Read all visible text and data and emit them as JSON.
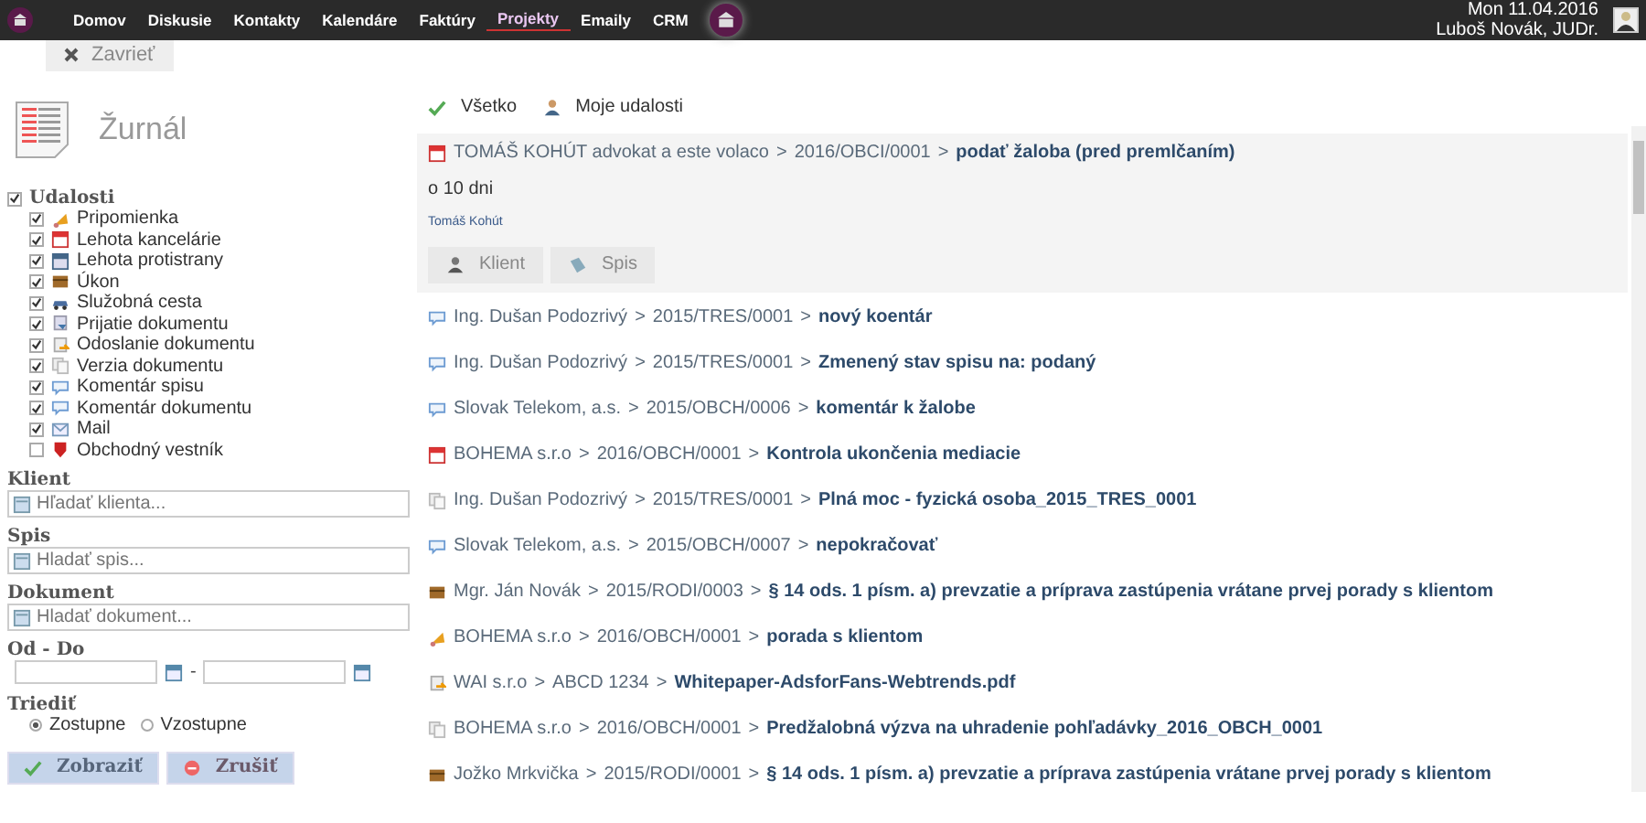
{
  "nav": {
    "items": [
      {
        "label": "Domov",
        "selected": false
      },
      {
        "label": "Diskusie",
        "selected": false
      },
      {
        "label": "Kontakty",
        "selected": false
      },
      {
        "label": "Kalendáre",
        "selected": false
      },
      {
        "label": "Faktúry",
        "selected": false
      },
      {
        "label": "Projekty",
        "selected": true
      },
      {
        "label": "Emaily",
        "selected": false
      },
      {
        "label": "CRM",
        "selected": false
      }
    ],
    "date": "Mon 11.04.2016",
    "user": "Luboš Novák, JUDr."
  },
  "close_button": "Zavrieť",
  "page_title": "Žurnál",
  "filters": {
    "group": {
      "label": "Udalosti",
      "checked": true
    },
    "categories": [
      {
        "label": "Pripomienka",
        "kind": "reminder",
        "checked": true
      },
      {
        "label": "Lehota kancelárie",
        "kind": "deadline",
        "checked": true
      },
      {
        "label": "Lehota protistrany",
        "kind": "opponent",
        "checked": true
      },
      {
        "label": "Úkon",
        "kind": "act",
        "checked": true
      },
      {
        "label": "Služobná cesta",
        "kind": "trip",
        "checked": true
      },
      {
        "label": "Prijatie dokumentu",
        "kind": "docin",
        "checked": true
      },
      {
        "label": "Odoslanie dokumentu",
        "kind": "docout",
        "checked": true
      },
      {
        "label": "Verzia dokumentu",
        "kind": "version",
        "checked": true
      },
      {
        "label": "Komentár spisu",
        "kind": "comment",
        "checked": true
      },
      {
        "label": "Komentár dokumentu",
        "kind": "comment",
        "checked": true
      },
      {
        "label": "Mail",
        "kind": "mail",
        "checked": true
      },
      {
        "label": "Obchodný vestník",
        "kind": "gazette",
        "checked": false
      }
    ],
    "fields": [
      {
        "label": "Klient",
        "placeholder": "Hľadať klienta..."
      },
      {
        "label": "Spis",
        "placeholder": "Hladať spis..."
      },
      {
        "label": "Dokument",
        "placeholder": "Hladať dokument..."
      }
    ],
    "range_label": "Od - Do",
    "range_separator": "-",
    "sort_label": "Triediť",
    "sort_options": [
      {
        "label": "Zostupne",
        "selected": true
      },
      {
        "label": "Vzostupne",
        "selected": false
      }
    ],
    "buttons": [
      {
        "label": "Zobraziť",
        "kind": "ok"
      },
      {
        "label": "Zrušiť",
        "kind": "cancel"
      }
    ]
  },
  "view_tabs": [
    {
      "label": "Všetko",
      "kind": "all"
    },
    {
      "label": "Moje udalosti",
      "kind": "mine"
    }
  ],
  "events": [
    {
      "kind": "deadline",
      "client": "TOMÁŠ KOHÚT advokat a este volaco",
      "file": "2016/OBCI/0001",
      "title": "podať žaloba (pred premlčaním)",
      "detail": {
        "due": "o 10 dni",
        "person": "Tomáš Kohút",
        "buttons": [
          {
            "label": "Klient",
            "kind": "client"
          },
          {
            "label": "Spis",
            "kind": "file"
          }
        ]
      }
    },
    {
      "kind": "comment",
      "client": "Ing. Dušan Podozrivý",
      "file": "2015/TRES/0001",
      "title": "nový koentár"
    },
    {
      "kind": "comment",
      "client": "Ing. Dušan Podozrivý",
      "file": "2015/TRES/0001",
      "title": "Zmenený stav spisu na: podaný"
    },
    {
      "kind": "comment",
      "client": "Slovak Telekom, a.s.",
      "file": "2015/OBCH/0006",
      "title": "komentár k žalobe"
    },
    {
      "kind": "deadline",
      "client": "BOHEMA s.r.o",
      "file": "2016/OBCH/0001",
      "title": "Kontrola ukončenia mediacie"
    },
    {
      "kind": "version",
      "client": "Ing. Dušan Podozrivý",
      "file": "2015/TRES/0001",
      "title": "Plná moc - fyzická osoba_2015_TRES_0001"
    },
    {
      "kind": "comment",
      "client": "Slovak Telekom, a.s.",
      "file": "2015/OBCH/0007",
      "title": "nepokračovať"
    },
    {
      "kind": "act",
      "client": "Mgr. Ján Novák",
      "file": "2015/RODI/0003",
      "title": "§ 14 ods. 1 písm. a) prevzatie a príprava zastúpenia vrátane prvej porady s klientom"
    },
    {
      "kind": "reminder",
      "client": "BOHEMA s.r.o",
      "file": "2016/OBCH/0001",
      "title": "porada s klientom"
    },
    {
      "kind": "docout",
      "client": "WAI s.r.o",
      "file": "ABCD 1234",
      "title": "Whitepaper-AdsforFans-Webtrends.pdf"
    },
    {
      "kind": "version",
      "client": "BOHEMA s.r.o",
      "file": "2016/OBCH/0001",
      "title": "Predžalobná výzva na uhradenie pohľadávky_2016_OBCH_0001"
    },
    {
      "kind": "act",
      "client": "Jožko Mrkvička",
      "file": "2015/RODI/0001",
      "title": "§ 14 ods. 1 písm. a) prevzatie a príprava zastúpenia vrátane prvej porady s klientom"
    }
  ],
  "separator": ">"
}
